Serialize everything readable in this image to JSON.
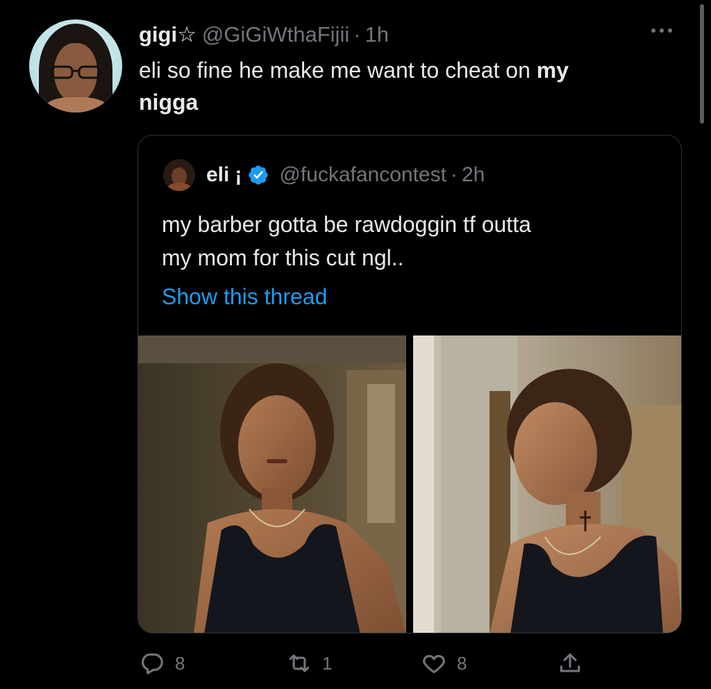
{
  "tweet": {
    "author_name": "gigi",
    "author_star": "☆",
    "handle": "@GiGiWthaFijii",
    "separator": "·",
    "time": "1h",
    "text_main": "eli so fine he make me want to cheat on ",
    "text_bold_1": "my",
    "text_bold_2": "nigga"
  },
  "quote": {
    "name": "eli",
    "name_suffix": "¡",
    "handle": "@fuckafancontest",
    "separator": "·",
    "time": "2h",
    "text_line_1": "my barber gotta be rawdoggin tf outta",
    "text_line_2": "my mom for this cut ngl..",
    "show_thread": "Show this thread"
  },
  "actions": {
    "replies": "8",
    "retweets": "1",
    "likes": "8"
  },
  "icons": {
    "verified": "verified-badge-icon",
    "more": "more-dots-icon",
    "reply": "reply-icon",
    "retweet": "retweet-icon",
    "like": "heart-icon",
    "share": "share-icon"
  },
  "colors": {
    "background": "#000000",
    "text": "#e7e9ea",
    "secondary_text": "#71767b",
    "link": "#1d9bf0",
    "border": "#2f3336"
  }
}
